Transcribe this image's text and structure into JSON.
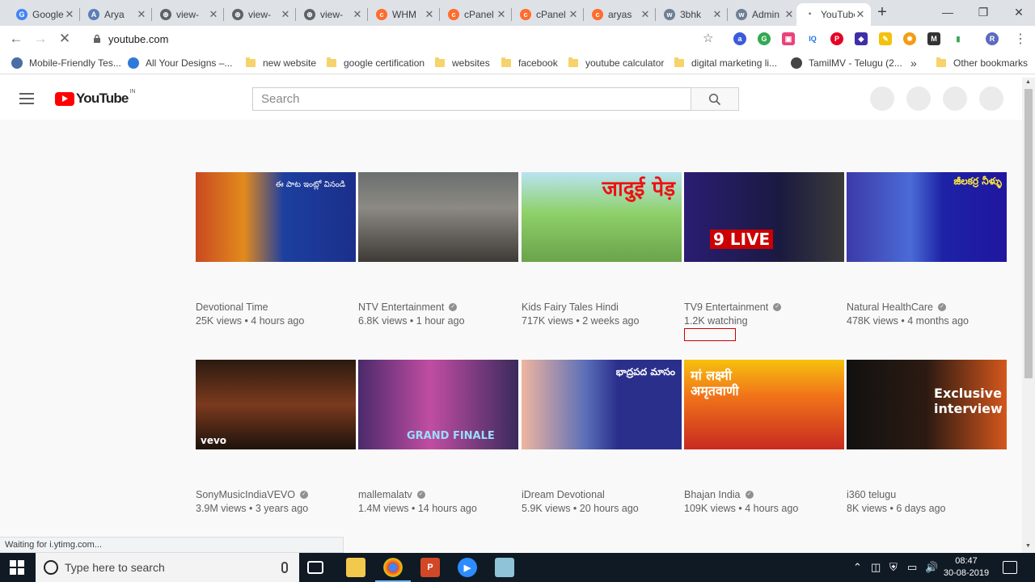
{
  "browser": {
    "tabs": [
      {
        "title": "Google",
        "fav_color": "#4285f4",
        "fav_char": "G"
      },
      {
        "title": "Arya",
        "fav_color": "#5b7fb5",
        "fav_char": "A"
      },
      {
        "title": "view-",
        "fav_color": "#5f6368",
        "fav_char": "⊕"
      },
      {
        "title": "view-",
        "fav_color": "#5f6368",
        "fav_char": "⊕"
      },
      {
        "title": "view-",
        "fav_color": "#5f6368",
        "fav_char": "⊕"
      },
      {
        "title": "WHM",
        "fav_color": "#ff6c2c",
        "fav_char": "c"
      },
      {
        "title": "cPanel",
        "fav_color": "#ff6c2c",
        "fav_char": "c"
      },
      {
        "title": "cPanel",
        "fav_color": "#ff6c2c",
        "fav_char": "c"
      },
      {
        "title": "aryas",
        "fav_color": "#ff6c2c",
        "fav_char": "c"
      },
      {
        "title": "3bhk",
        "fav_color": "#6d7f94",
        "fav_char": "w"
      },
      {
        "title": "Admin",
        "fav_color": "#6d7f94",
        "fav_char": "w"
      },
      {
        "title": "YouTube",
        "fav_color": "#ffffff",
        "fav_char": "·",
        "active": true
      }
    ],
    "url": "youtube.com",
    "bookmarks": [
      {
        "label": "Mobile-Friendly Tes...",
        "type": "site",
        "color": "#4a6fa5"
      },
      {
        "label": "All Your Designs –...",
        "type": "site",
        "color": "#2f7ad8"
      },
      {
        "label": "new website",
        "type": "folder"
      },
      {
        "label": "google certification",
        "type": "folder"
      },
      {
        "label": "websites",
        "type": "folder"
      },
      {
        "label": "facebook",
        "type": "folder"
      },
      {
        "label": "youtube calculator",
        "type": "folder"
      },
      {
        "label": "digital marketing li...",
        "type": "folder"
      },
      {
        "label": "TamilMV - Telugu (2...",
        "type": "site",
        "color": "#444444"
      }
    ],
    "more_bookmarks": "»",
    "other_bookmarks": "Other bookmarks",
    "status": "Waiting for i.ytimg.com..."
  },
  "youtube": {
    "logo_text": "YouTube",
    "logo_region": "IN",
    "search_placeholder": "Search",
    "videos": [
      {
        "channel": "Devotional Time",
        "verified": false,
        "stats": "25K views • 4 hours ago",
        "thumb": "devotional-1",
        "overlay": "ఈ పాట ఇంట్లో వినండి"
      },
      {
        "channel": "NTV Entertainment",
        "verified": true,
        "stats": "6.8K views • 1 hour ago",
        "thumb": "news-crowd",
        "overlay": ""
      },
      {
        "channel": "Kids Fairy Tales Hindi",
        "verified": false,
        "stats": "717K views • 2 weeks ago",
        "thumb": "cartoon-tree",
        "overlay": "जादुई पेड़"
      },
      {
        "channel": "TV9 Entertainment",
        "verified": true,
        "stats": "1.2K watching",
        "thumb": "tv9-live",
        "overlay": "9 LIVE"
      },
      {
        "channel": "Natural HealthCare",
        "verified": true,
        "stats": "478K views • 4 months ago",
        "thumb": "doctor",
        "overlay": "జీలకర్ర నీళ్ళు"
      },
      {
        "channel": "SonyMusicIndiaVEVO",
        "verified": true,
        "stats": "3.9M views • 3 years ago",
        "thumb": "vevo",
        "overlay": "vevo"
      },
      {
        "channel": "mallemalatv",
        "verified": true,
        "stats": "1.4M views • 14 hours ago",
        "thumb": "grand-finale",
        "overlay": "GRAND FINALE"
      },
      {
        "channel": "iDream Devotional",
        "verified": false,
        "stats": "5.9K views • 20 hours ago",
        "thumb": "speaker",
        "overlay": "భాద్రపద మాసం"
      },
      {
        "channel": "Bhajan India",
        "verified": true,
        "stats": "109K views • 4 hours ago",
        "thumb": "lakshmi",
        "overlay": "मां लक्ष्मी अमृतवाणी"
      },
      {
        "channel": "i360 telugu",
        "verified": false,
        "stats": "8K views • 6 days ago",
        "thumb": "interview",
        "overlay": "Exclusive interview"
      }
    ]
  },
  "taskbar": {
    "search_placeholder": "Type here to search",
    "time": "08:47",
    "date": "30-08-2019"
  }
}
